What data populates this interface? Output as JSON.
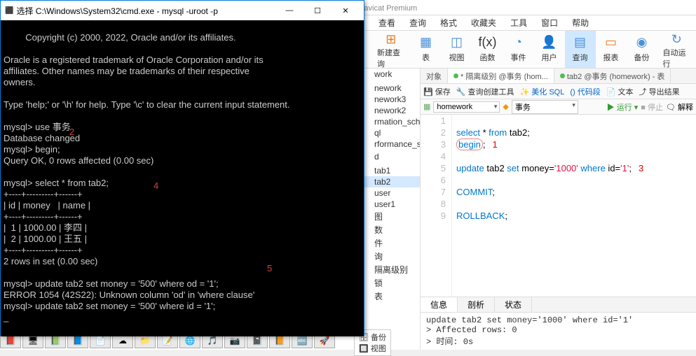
{
  "navicat": {
    "title": "务 (homework) - 查询 - Navicat Premium",
    "menu": [
      "查看",
      "查询",
      "格式",
      "收藏夹",
      "工具",
      "窗口",
      "帮助"
    ],
    "ribbon": [
      {
        "label": "新建查询",
        "icon": "⊞",
        "color": "#e67e22"
      },
      {
        "label": "表",
        "icon": "▦",
        "color": "#4a90d9"
      },
      {
        "label": "视图",
        "icon": "◫",
        "color": "#4a90d9"
      },
      {
        "label": "函数",
        "icon": "f(x)",
        "color": "#333"
      },
      {
        "label": "事件",
        "icon": "◔",
        "color": "#4a90d9"
      },
      {
        "label": "用户",
        "icon": "👤",
        "color": "#e67e22"
      },
      {
        "label": "查询",
        "icon": "▤",
        "color": "#4a90d9",
        "active": true
      },
      {
        "label": "报表",
        "icon": "▭",
        "color": "#e67e22"
      },
      {
        "label": "备份",
        "icon": "◉",
        "color": "#4a90d9"
      },
      {
        "label": "自动运行",
        "icon": "↻",
        "color": "#4a90d9"
      }
    ],
    "tree": [
      "work",
      "",
      "",
      "nework",
      "nework3",
      "nework2",
      "rmation_schema",
      "ql",
      "rformance_schema",
      "",
      "d",
      "",
      "",
      "tab1",
      "tab2",
      "user",
      "user1",
      "图",
      "数",
      "件",
      "询",
      "隔离级别",
      "锁",
      "表"
    ],
    "tabs": [
      {
        "label": "对象"
      },
      {
        "label": "* 隔离级别 @事务 (hom...",
        "dot": true
      },
      {
        "label": "tab2 @事务 (homework) - 表",
        "dot": true
      }
    ],
    "toolbar": [
      "保存",
      "查询创建工具",
      "美化 SQL",
      "代码段",
      "文本",
      "导出结果"
    ],
    "db_dropdown": "homework",
    "schema_dropdown": "事务",
    "run": "运行",
    "stop": "停止",
    "explain": "解释",
    "code_lines": [
      {
        "n": 1,
        "html": ""
      },
      {
        "n": 2,
        "html": "<span class='kw'>select</span> * <span class='kw'>from</span> tab2;"
      },
      {
        "n": 3,
        "html": "<span class='kw circled'>begin</span>;<span class='anno-red'>1</span>"
      },
      {
        "n": 4,
        "html": ""
      },
      {
        "n": 5,
        "html": "<span class='kw'>update</span> tab2 <span class='kw'>set</span> money=<span class='str'>'1000'</span> <span class='kw'>where</span> id=<span class='str'>'1'</span>;<span class='anno-red'>3</span>"
      },
      {
        "n": 6,
        "html": ""
      },
      {
        "n": 7,
        "html": "<span class='kw'>COMMIT</span>;"
      },
      {
        "n": 8,
        "html": ""
      },
      {
        "n": 9,
        "html": "<span class='kw'>ROLLBACK</span>;"
      }
    ],
    "result_tabs": [
      "信息",
      "剖析",
      "状态"
    ],
    "result_out": [
      "update tab2 set money='1000' where id='1'",
      "> Affected rows: 0",
      "> 时间: 0s"
    ]
  },
  "cmd": {
    "title": "选择 C:\\Windows\\System32\\cmd.exe - mysql  -uroot -p",
    "body": "Copyright (c) 2000, 2022, Oracle and/or its affiliates.\n\nOracle is a registered trademark of Oracle Corporation and/or its\naffiliates. Other names may be trademarks of their respective\nowners.\n\nType 'help;' or '\\h' for help. Type '\\c' to clear the current input statement.\n\nmysql> use 事务\nDatabase changed\nmysql> begin;\nQuery OK, 0 rows affected (0.00 sec)\n\nmysql> select * from tab2;\n+----+---------+------+\n| id | money   | name |\n+----+---------+------+\n|  1 | 1000.00 | 李四 |\n|  2 | 1000.00 | 王五 |\n+----+---------+------+\n2 rows in set (0.00 sec)\n\nmysql> update tab2 set money = '500' where od = '1';\nERROR 1054 (42S22): Unknown column 'od' in 'where clause'\nmysql> update tab2 set money = '500' where id = '1';\n_",
    "anno2": "2",
    "anno4": "4",
    "anno5": "5"
  },
  "side": {
    "backup": "备份",
    "view": "视图"
  }
}
